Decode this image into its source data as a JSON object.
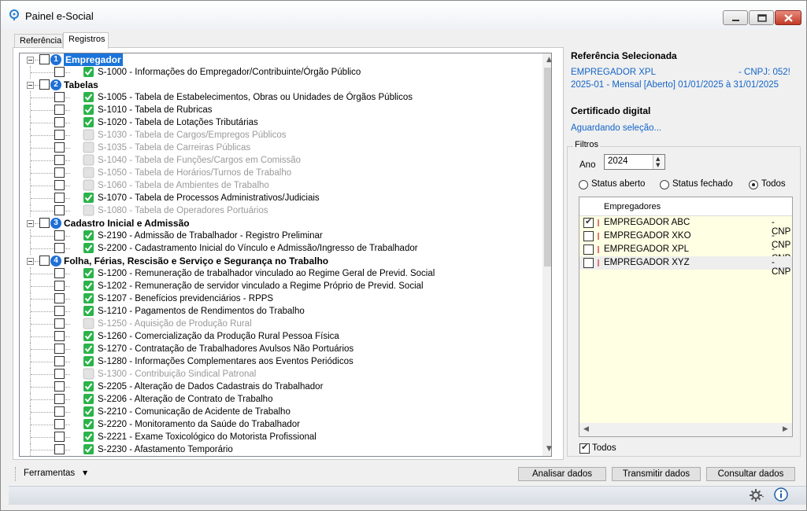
{
  "window": {
    "title": "Painel e-Social"
  },
  "tabs": [
    {
      "label": "Referência"
    },
    {
      "label": "Registros"
    }
  ],
  "tree": {
    "groups": [
      {
        "num": "1",
        "label": "Empregador",
        "selected": true,
        "items": [
          {
            "label": "S-1000 - Informações do Empregador/Contribuinte/Órgão Público",
            "status": "ok"
          }
        ]
      },
      {
        "num": "2",
        "label": "Tabelas",
        "items": [
          {
            "label": "S-1005 - Tabela de Estabelecimentos, Obras ou Unidades de Órgãos Públicos",
            "status": "ok"
          },
          {
            "label": "S-1010 - Tabela de Rubricas",
            "status": "ok"
          },
          {
            "label": "S-1020 - Tabela de Lotações Tributárias",
            "status": "ok"
          },
          {
            "label": "S-1030 - Tabela de Cargos/Empregos Públicos",
            "status": "disabled"
          },
          {
            "label": "S-1035 - Tabela de Carreiras Públicas",
            "status": "disabled"
          },
          {
            "label": "S-1040 - Tabela de Funções/Cargos em Comissão",
            "status": "disabled"
          },
          {
            "label": "S-1050 - Tabela de Horários/Turnos de Trabalho",
            "status": "disabled"
          },
          {
            "label": "S-1060 - Tabela de Ambientes de Trabalho",
            "status": "disabled"
          },
          {
            "label": "S-1070 - Tabela de Processos Administrativos/Judiciais",
            "status": "ok"
          },
          {
            "label": "S-1080 - Tabela de Operadores Portuários",
            "status": "disabled"
          }
        ]
      },
      {
        "num": "3",
        "label": "Cadastro Inicial e Admissão",
        "items": [
          {
            "label": "S-2190 - Admissão de Trabalhador - Registro Preliminar",
            "status": "ok"
          },
          {
            "label": "S-2200 - Cadastramento Inicial do Vínculo e Admissão/Ingresso de Trabalhador",
            "status": "ok"
          }
        ]
      },
      {
        "num": "4",
        "label": "Folha, Férias, Rescisão e Serviço e Segurança no Trabalho",
        "items": [
          {
            "label": "S-1200 - Remuneração de trabalhador vinculado ao Regime Geral de Previd. Social",
            "status": "ok"
          },
          {
            "label": "S-1202 - Remuneração de servidor vinculado a Regime Próprio de Previd. Social",
            "status": "ok"
          },
          {
            "label": "S-1207 - Benefícios previdenciários - RPPS",
            "status": "ok"
          },
          {
            "label": "S-1210 - Pagamentos de Rendimentos do Trabalho",
            "status": "ok"
          },
          {
            "label": "S-1250 - Aquisição de Produção Rural",
            "status": "disabled"
          },
          {
            "label": "S-1260 - Comercialização da Produção Rural Pessoa Física",
            "status": "ok"
          },
          {
            "label": "S-1270 - Contratação de Trabalhadores Avulsos Não Portuários",
            "status": "ok"
          },
          {
            "label": "S-1280 - Informações Complementares aos Eventos Periódicos",
            "status": "ok"
          },
          {
            "label": "S-1300 - Contribuição Sindical Patronal",
            "status": "disabled"
          },
          {
            "label": "S-2205 - Alteração de Dados Cadastrais do Trabalhador",
            "status": "ok"
          },
          {
            "label": "S-2206 - Alteração de Contrato de Trabalho",
            "status": "ok"
          },
          {
            "label": "S-2210 - Comunicação de Acidente de Trabalho",
            "status": "ok"
          },
          {
            "label": "S-2220 - Monitoramento da Saúde do Trabalhador",
            "status": "ok"
          },
          {
            "label": "S-2221 -  Exame Toxicológico do Motorista Profissional",
            "status": "ok"
          },
          {
            "label": "S-2230 - Afastamento Temporário",
            "status": "ok"
          }
        ]
      }
    ]
  },
  "referencia": {
    "title": "Referência Selecionada",
    "empregador": "EMPREGADOR XPL",
    "cnpj": "- CNPJ: 052!",
    "periodo": "2025-01 - Mensal [Aberto] 01/01/2025 à 31/01/2025"
  },
  "certificado": {
    "title": "Certificado digital",
    "status": "Aguardando seleção..."
  },
  "filtros": {
    "title": "Filtros",
    "ano_label": "Ano",
    "ano": "2024",
    "status_options": [
      {
        "label": "Status aberto",
        "selected": false
      },
      {
        "label": "Status fechado",
        "selected": false
      },
      {
        "label": "Todos",
        "selected": true
      }
    ],
    "grid_header": "Empregadores",
    "empregadores": [
      {
        "name": "EMPREGADOR ABC",
        "cnpj": "- CNP",
        "checked": true
      },
      {
        "name": "EMPREGADOR XKO",
        "cnpj": "- CNP",
        "checked": false
      },
      {
        "name": "EMPREGADOR XPL",
        "cnpj": "- CNP",
        "checked": false
      },
      {
        "name": "EMPREGADOR XYZ",
        "cnpj": "- CNP",
        "checked": false
      }
    ],
    "todos_label": "Todos",
    "todos_checked": true
  },
  "toolbar": {
    "ferramentas": "Ferramentas",
    "analisar": "Analisar dados",
    "transmitir": "Transmitir dados",
    "consultar": "Consultar dados"
  },
  "colors": {
    "accent": "#1a74d9",
    "ok_green": "#2bb34a",
    "link": "#1464c8"
  }
}
